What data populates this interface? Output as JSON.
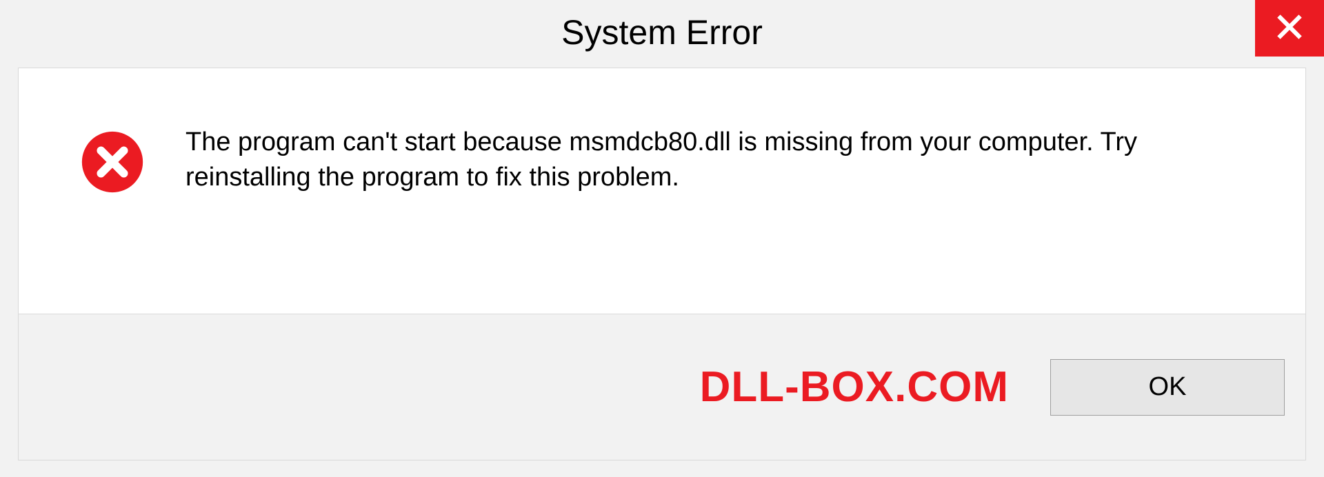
{
  "titlebar": {
    "title": "System Error",
    "close_icon": "close-icon"
  },
  "dialog": {
    "message": "The program can't start because msmdcb80.dll is missing from your computer. Try reinstalling the program to fix this problem.",
    "error_icon": "error-circle-x-icon"
  },
  "footer": {
    "watermark": "DLL-BOX.COM",
    "ok_label": "OK"
  },
  "colors": {
    "accent_red": "#eb1b22",
    "panel_bg": "#ffffff",
    "window_bg": "#f2f2f2",
    "btn_bg": "#e6e6e6"
  }
}
